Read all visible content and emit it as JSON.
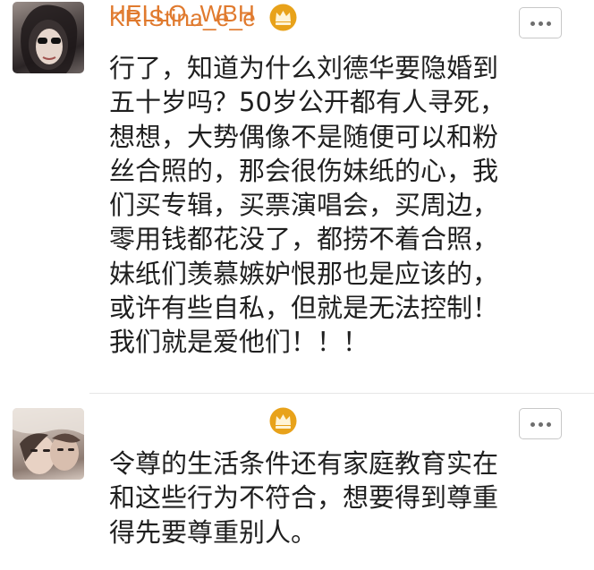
{
  "comments": [
    {
      "username": "KRIStina_e_e",
      "badge_icon": "crown-icon",
      "lines": [
        "行了，知道为什么刘德华要隐婚到",
        "五十岁吗？50岁公开都有人寻死，",
        "想想，大势偶像不是随便可以和粉",
        "丝合照的，那会很伤妹纸的心，我",
        "们买专辑，买票演唱会，买周边，",
        "零用钱都花没了，都捞不着合照，",
        "妹纸们羡慕嫉妒恨那也是应该的，",
        "或许有些自私，但就是无法控制！",
        "我们就是爱他们！！！"
      ]
    },
    {
      "username": "HELLO_WBH",
      "badge_icon": "crown-icon",
      "lines": [
        "令尊的生活条件还有家庭教育实在",
        "和这些行为不符合，想要得到尊重",
        "得先要尊重别人。"
      ]
    }
  ],
  "colors": {
    "username": "#e07a2e",
    "crown": "#e8a21a",
    "text": "#1f1f1f",
    "more_border": "#c8c8c8"
  }
}
